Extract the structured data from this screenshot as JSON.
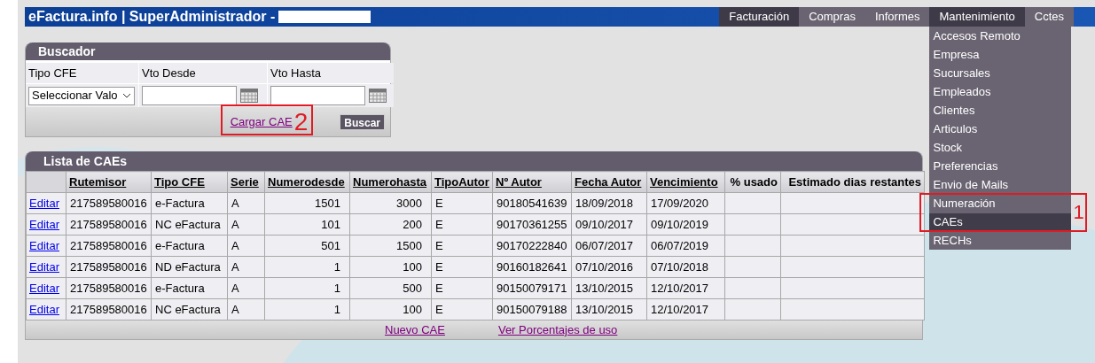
{
  "header": {
    "title": "eFactura.info | SuperAdministrador -"
  },
  "nav": [
    {
      "label": "Facturación",
      "selected": true,
      "expanded": false
    },
    {
      "label": "Compras",
      "selected": false,
      "expanded": false
    },
    {
      "label": "Informes",
      "selected": false,
      "expanded": false
    },
    {
      "label": "Mantenimiento",
      "selected": true,
      "expanded": true
    },
    {
      "label": "Cctes",
      "selected": false,
      "expanded": false
    }
  ],
  "menu": [
    {
      "label": "Accesos Remoto",
      "selected": false
    },
    {
      "label": "Empresa",
      "selected": false
    },
    {
      "label": "Sucursales",
      "selected": false
    },
    {
      "label": "Empleados",
      "selected": false
    },
    {
      "label": "Clientes",
      "selected": false
    },
    {
      "label": "Articulos",
      "selected": false
    },
    {
      "label": "Stock",
      "selected": false
    },
    {
      "label": "Preferencias",
      "selected": false
    },
    {
      "label": "Envio de Mails",
      "selected": false
    },
    {
      "label": "Numeración",
      "selected": false
    },
    {
      "label": "CAEs",
      "selected": true
    },
    {
      "label": "RECHs",
      "selected": false
    }
  ],
  "menu_callout": "1",
  "search": {
    "title": "Buscador",
    "fields": [
      {
        "kind": "select",
        "label": "Tipo CFE",
        "value": "Seleccionar Valo"
      },
      {
        "kind": "date",
        "label": "Vto Desde"
      },
      {
        "kind": "date",
        "label": "Vto Hasta"
      }
    ],
    "link": "Cargar CAE",
    "callout": "2",
    "button": "Buscar"
  },
  "list": {
    "title": "Lista de CAEs",
    "columns": [
      {
        "label": "Rutemisor",
        "sortable": true
      },
      {
        "label": "Tipo CFE",
        "sortable": true
      },
      {
        "label": "Serie",
        "sortable": true
      },
      {
        "label": "Numerodesde",
        "sortable": true
      },
      {
        "label": "Numerohasta",
        "sortable": true
      },
      {
        "label": "TipoAutor",
        "sortable": true
      },
      {
        "label": "Nº Autor",
        "sortable": true
      },
      {
        "label": "Fecha Autor",
        "sortable": true
      },
      {
        "label": "Vencimiento",
        "sortable": true
      },
      {
        "label": "% usado",
        "sortable": false
      },
      {
        "label": "Estimado dias restantes",
        "sortable": false
      }
    ],
    "rows": [
      {
        "action": "Editar",
        "cells": [
          "217589580016",
          "e-Factura",
          "A",
          "1501",
          "3000",
          "E",
          "90180541639",
          "18/09/2018",
          "17/09/2020"
        ]
      },
      {
        "action": "Editar",
        "cells": [
          "217589580016",
          "NC eFactura",
          "A",
          "101",
          "200",
          "E",
          "90170361255",
          "09/10/2017",
          "09/10/2019"
        ]
      },
      {
        "action": "Editar",
        "cells": [
          "217589580016",
          "e-Factura",
          "A",
          "501",
          "1500",
          "E",
          "90170222840",
          "06/07/2017",
          "06/07/2019"
        ]
      },
      {
        "action": "Editar",
        "cells": [
          "217589580016",
          "ND eFactura",
          "A",
          "1",
          "100",
          "E",
          "90160182641",
          "07/10/2016",
          "07/10/2018"
        ]
      },
      {
        "action": "Editar",
        "cells": [
          "217589580016",
          "e-Factura",
          "A",
          "1",
          "500",
          "E",
          "90150079171",
          "13/10/2015",
          "12/10/2017"
        ]
      },
      {
        "action": "Editar",
        "cells": [
          "217589580016",
          "NC eFactura",
          "A",
          "1",
          "100",
          "E",
          "90150079188",
          "13/10/2015",
          "12/10/2017"
        ]
      }
    ],
    "footer_links": [
      "Nuevo CAE",
      "Ver Porcentajes de uso"
    ]
  }
}
